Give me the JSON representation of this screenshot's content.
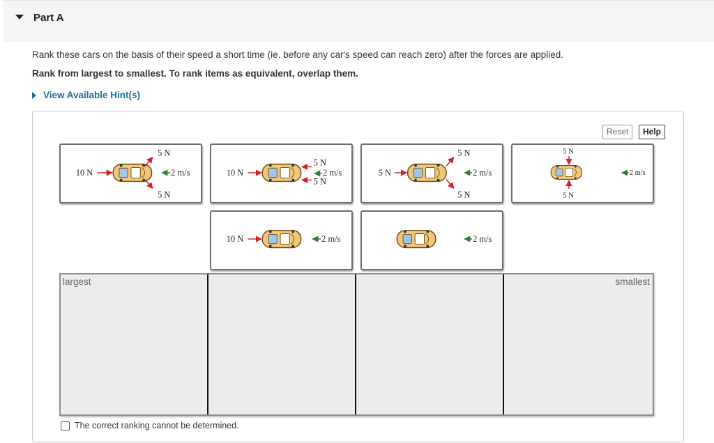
{
  "part": {
    "title": "Part A"
  },
  "instructions": {
    "line1": "Rank these cars on the basis of their speed a short time (ie. before any car's speed can reach zero) after the forces are applied.",
    "line2": "Rank from largest to smallest. To rank items as equivalent, overlap them."
  },
  "hint": {
    "label": "View Available Hint(s)"
  },
  "toolbar": {
    "reset_label": "Reset",
    "help_label": "Help"
  },
  "tiles": [
    {
      "forces": [
        "10 N",
        "5 N",
        "5 N"
      ],
      "velocity": "2 m/s"
    },
    {
      "forces": [
        "10 N",
        "5 N",
        "5 N"
      ],
      "velocity": "2 m/s"
    },
    {
      "forces": [
        "5 N",
        "5 N",
        "5 N"
      ],
      "velocity": "2 m/s"
    },
    {
      "forces": [
        "5 N",
        "5 N"
      ],
      "velocity": "2 m/s"
    },
    {
      "forces": [
        "10 N"
      ],
      "velocity": "2 m/s"
    },
    {
      "forces": [],
      "velocity": "2 m/s"
    }
  ],
  "ranking": {
    "largest_label": "largest",
    "smallest_label": "smallest",
    "slot_count": 4
  },
  "cannot_determine": {
    "label": "The correct ranking cannot be determined.",
    "checked": false
  },
  "colors": {
    "car_body": "#f3c77a",
    "car_outline": "#6b4b12",
    "window": "#9fc7e8",
    "arrow": "#d42020",
    "velocity_arrow": "#2e7d32",
    "link": "#1a6d9c"
  }
}
